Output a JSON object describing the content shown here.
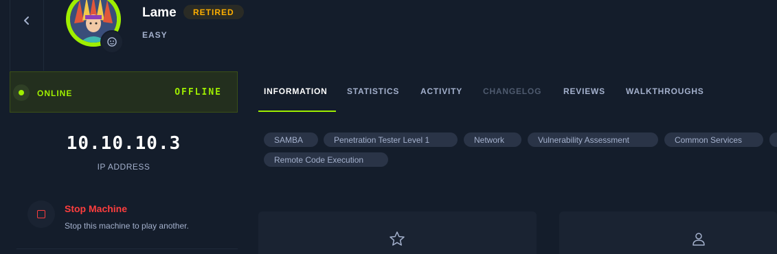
{
  "header": {
    "machine_name": "Lame",
    "status_badge": "RETIRED",
    "difficulty": "EASY"
  },
  "status": {
    "state": "ONLINE",
    "toggle_label": "OFFLINE"
  },
  "connection": {
    "ip": "10.10.10.3",
    "ip_label": "IP ADDRESS"
  },
  "actions": {
    "stop_title": "Stop Machine",
    "stop_description": "Stop this machine to play another."
  },
  "tabs": [
    {
      "label": "INFORMATION",
      "state": "active"
    },
    {
      "label": "STATISTICS",
      "state": "normal"
    },
    {
      "label": "ACTIVITY",
      "state": "normal"
    },
    {
      "label": "CHANGELOG",
      "state": "disabled"
    },
    {
      "label": "REVIEWS",
      "state": "normal"
    },
    {
      "label": "WALKTHROUGHS",
      "state": "normal"
    }
  ],
  "tags": [
    "SAMBA",
    "Penetration Tester Level 1",
    "Network",
    "Vulnerability Assessment",
    "Common Services",
    "Remote Code Execution"
  ],
  "cards": [
    {
      "icon": "star-icon"
    },
    {
      "icon": "user-icon"
    }
  ],
  "colors": {
    "background": "#141d2b",
    "panel": "#1a2332",
    "accent_green": "#9fef00",
    "retired_orange": "#ffaf00",
    "danger_red": "#ff3e3e",
    "muted_text": "#a4b1cd",
    "tag_bg": "#2a3447"
  }
}
